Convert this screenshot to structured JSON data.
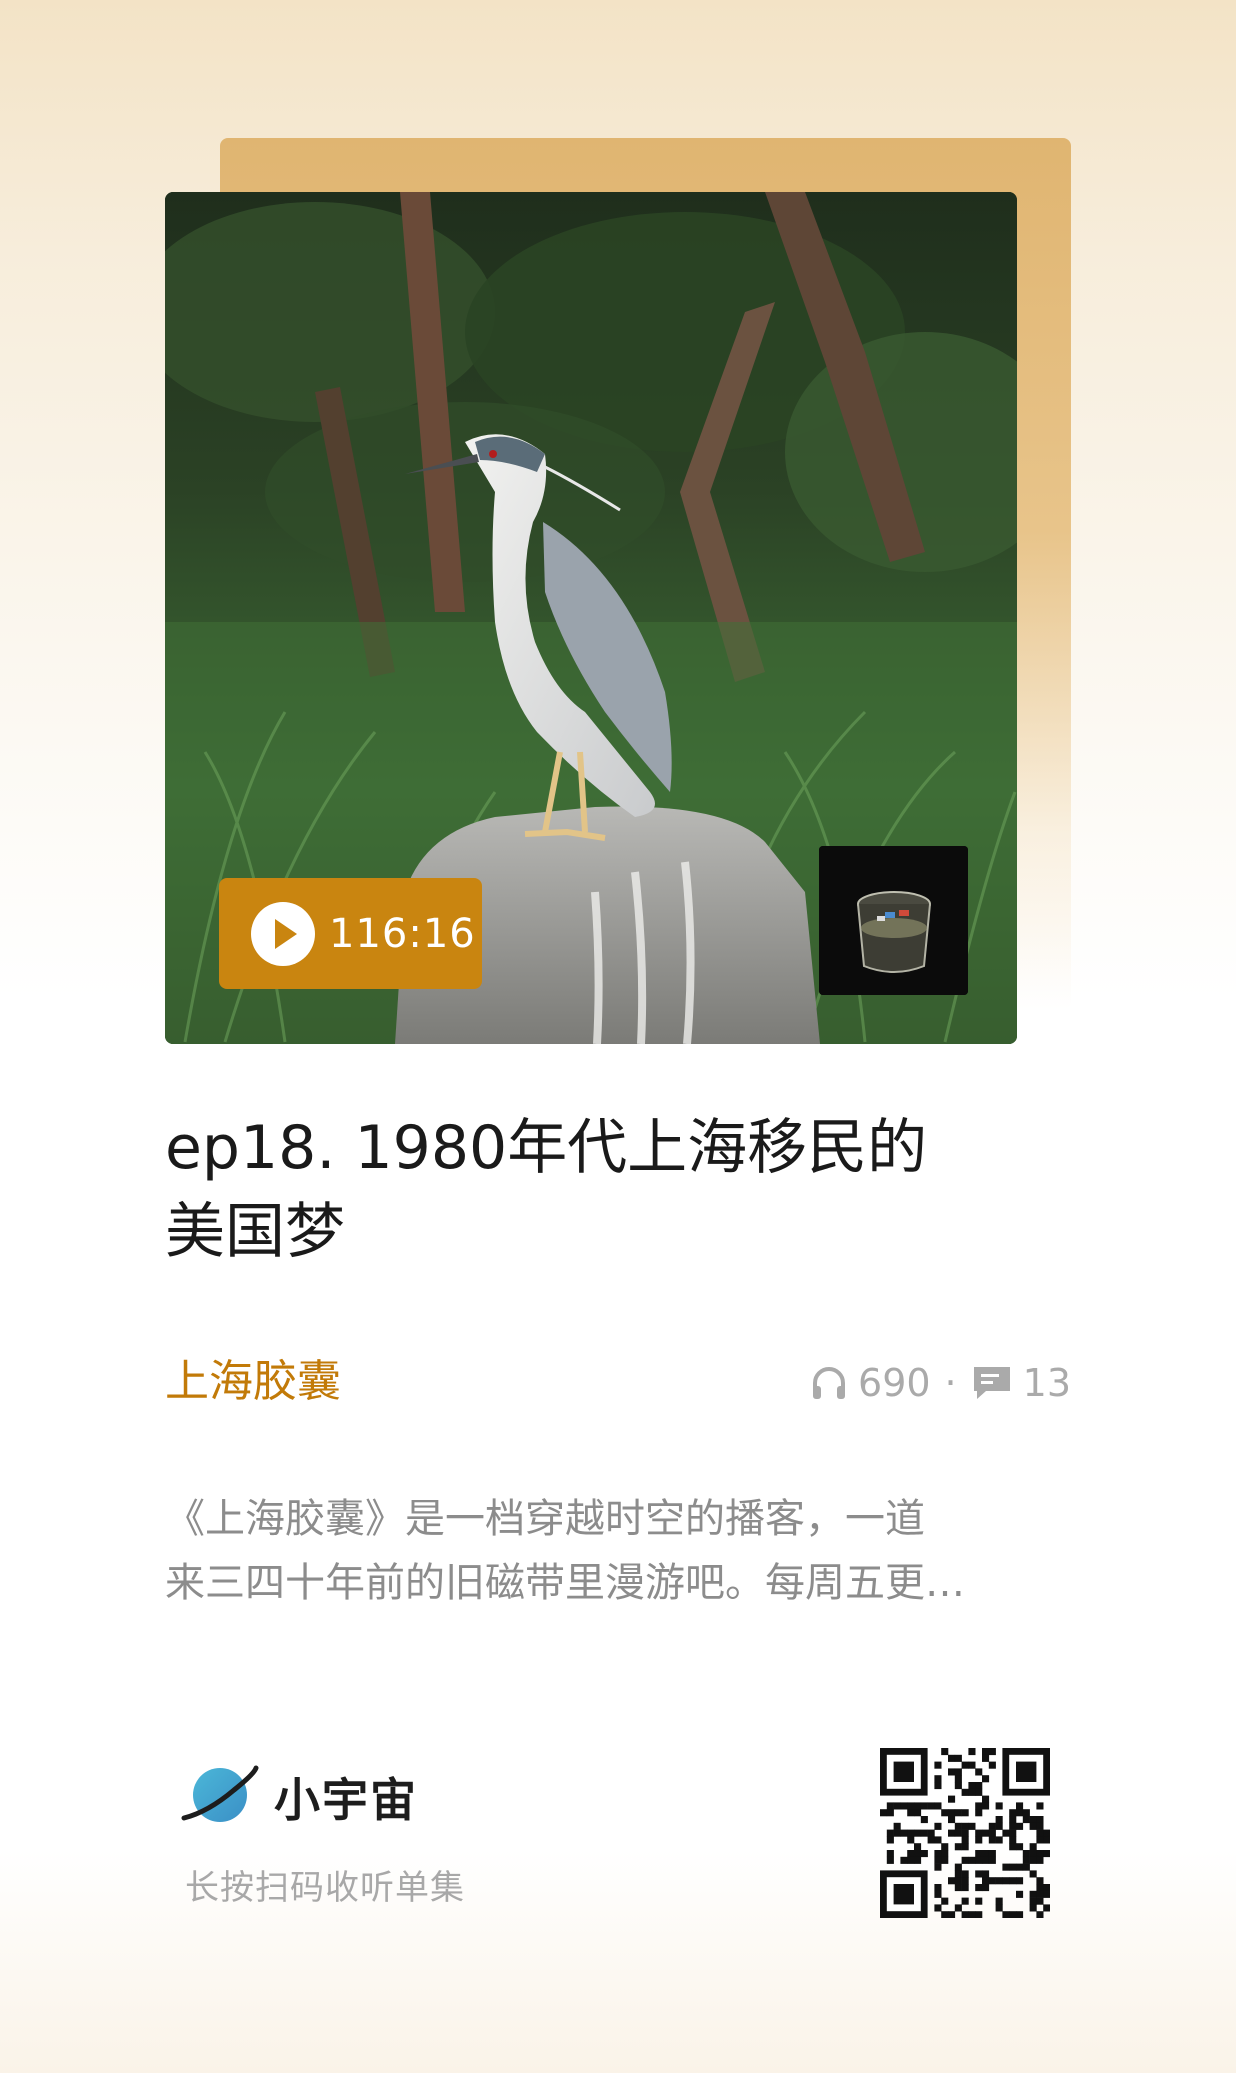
{
  "episode": {
    "title_line1": "ep18. 1980年代上海移民的",
    "title_line2": "美国梦",
    "duration": "116:16",
    "cover_icon": "heron-photo",
    "thumbnail_icon": "glass-of-water-image"
  },
  "podcast": {
    "name": "上海胶囊",
    "plays": "690",
    "separator": "·",
    "comments": "13",
    "description_line1": "《上海胶囊》是一档穿越时空的播客，一道",
    "description_line2": "来三四十年前的旧磁带里漫游吧。每周五更…"
  },
  "footer": {
    "brand": "小宇宙",
    "hint": "长按扫码收听单集",
    "qr_icon": "qr-code-icon"
  },
  "colors": {
    "accent": "#c98510",
    "podcast_name": "#c27a08",
    "card_back": "#e0b571"
  }
}
